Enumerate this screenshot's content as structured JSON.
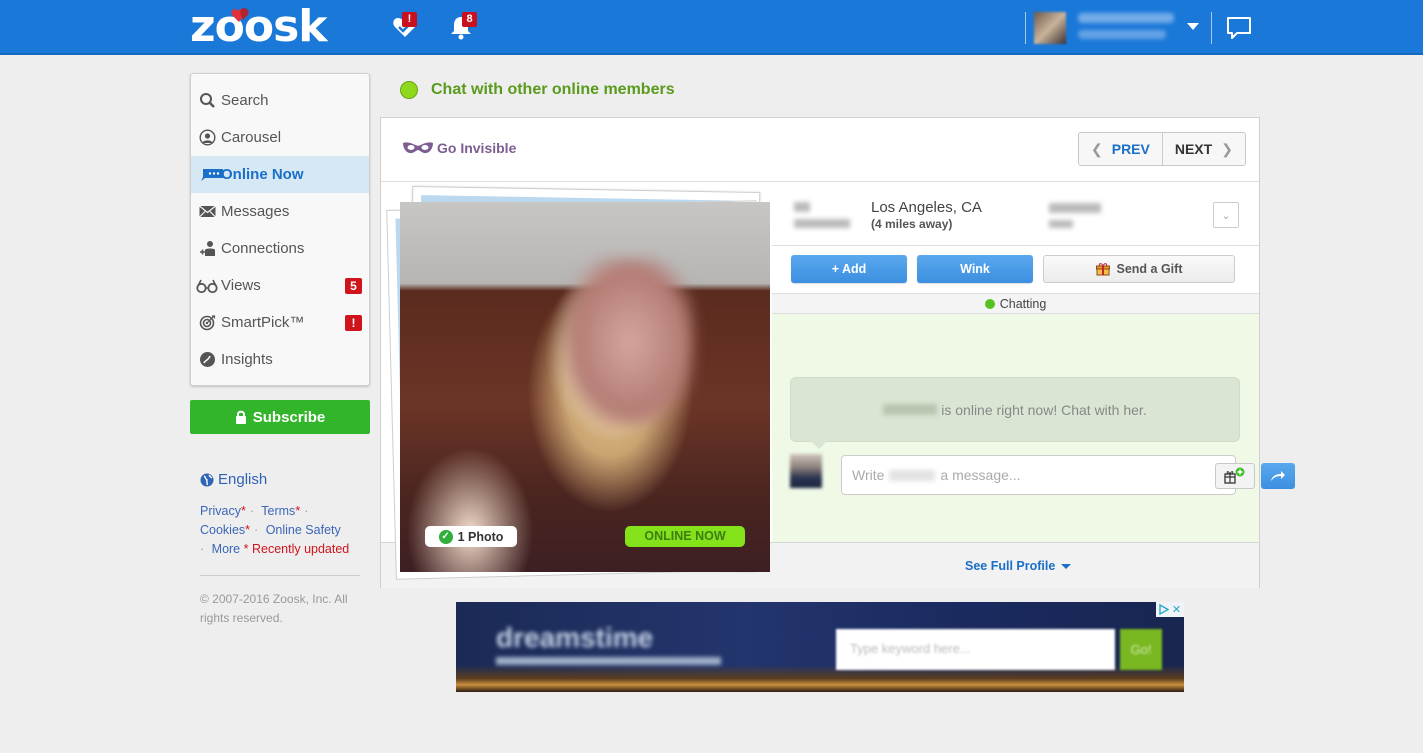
{
  "header": {
    "logo_text": "zoosk",
    "smartpick_badge": "!",
    "notifications_badge": "8",
    "icons": {
      "smartpick": "heart-check-icon",
      "notifications": "bell-icon",
      "messages": "chat-bubble-icon",
      "menu": "chevron-down-icon"
    },
    "colors": {
      "bar": "#1a78d8",
      "badge": "#c8101e"
    }
  },
  "sidebar": {
    "items": [
      {
        "label": "Search",
        "icon": "search-icon",
        "active": false
      },
      {
        "label": "Carousel",
        "icon": "carousel-icon",
        "active": false
      },
      {
        "label": "Online Now",
        "icon": "chat-dots-icon",
        "active": true
      },
      {
        "label": "Messages",
        "icon": "envelope-icon",
        "active": false
      },
      {
        "label": "Connections",
        "icon": "add-person-icon",
        "active": false
      },
      {
        "label": "Views",
        "icon": "glasses-icon",
        "active": false,
        "badge": "5"
      },
      {
        "label": "SmartPick™",
        "icon": "target-icon",
        "active": false,
        "badge": "!"
      },
      {
        "label": "Insights",
        "icon": "insights-icon",
        "active": false
      }
    ],
    "subscribe_label": "Subscribe",
    "language": "English",
    "footer_links": {
      "privacy": "Privacy",
      "terms": "Terms",
      "cookies": "Cookies",
      "online_safety": "Online Safety",
      "more": "More",
      "asterisk": "*",
      "recently_updated": "* Recently updated",
      "separator": "·"
    },
    "copyright": "© 2007-2016 Zoosk, Inc. All rights reserved."
  },
  "main": {
    "heading": "Chat with other online members",
    "go_invisible": "Go Invisible",
    "prev_label": "PREV",
    "next_label": "NEXT",
    "profile": {
      "location": "Los Angeles, CA",
      "distance": "(4 miles away)",
      "photo_count": "1 Photo",
      "online_badge": "ONLINE NOW"
    },
    "actions": {
      "add": "+ Add",
      "wink": "Wink",
      "gift": "Send a Gift"
    },
    "chat": {
      "status": "Chatting",
      "prompt": "is online right now! Chat with her.",
      "placeholder_prefix": "Write",
      "placeholder_suffix": "a message..."
    },
    "see_full_profile": "See Full Profile"
  },
  "ad": {
    "brand": "dreamstime",
    "search_placeholder": "Type keyword here...",
    "go_label": "Go!",
    "close": "✕"
  }
}
